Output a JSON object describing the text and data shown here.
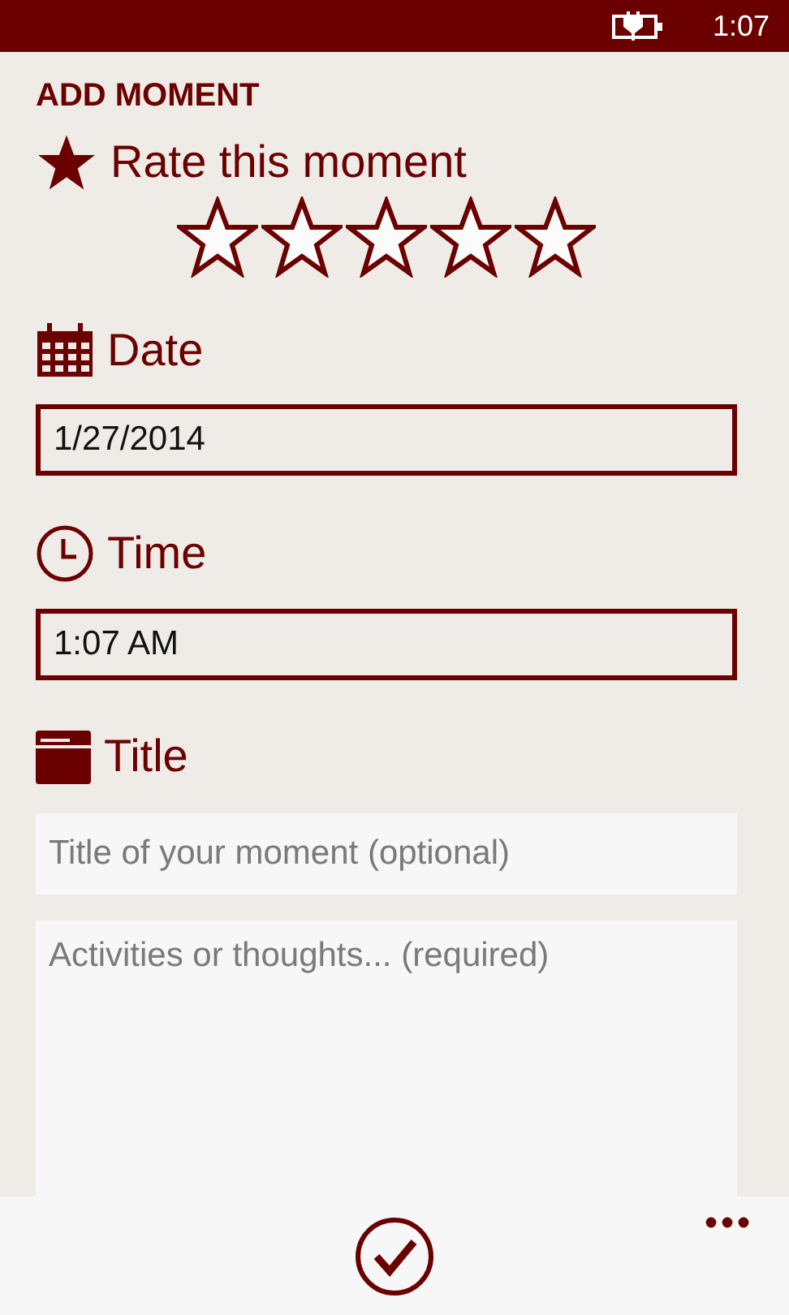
{
  "status_bar": {
    "time": "1:07"
  },
  "page_title": "ADD MOMENT",
  "rating": {
    "label": "Rate this moment",
    "stars": 0
  },
  "date": {
    "label": "Date",
    "value": "1/27/2014"
  },
  "time": {
    "label": "Time",
    "value": "1:07 AM"
  },
  "title": {
    "label": "Title",
    "placeholder": "Title of your moment (optional)"
  },
  "notes": {
    "placeholder": "Activities or thoughts... (required)"
  }
}
